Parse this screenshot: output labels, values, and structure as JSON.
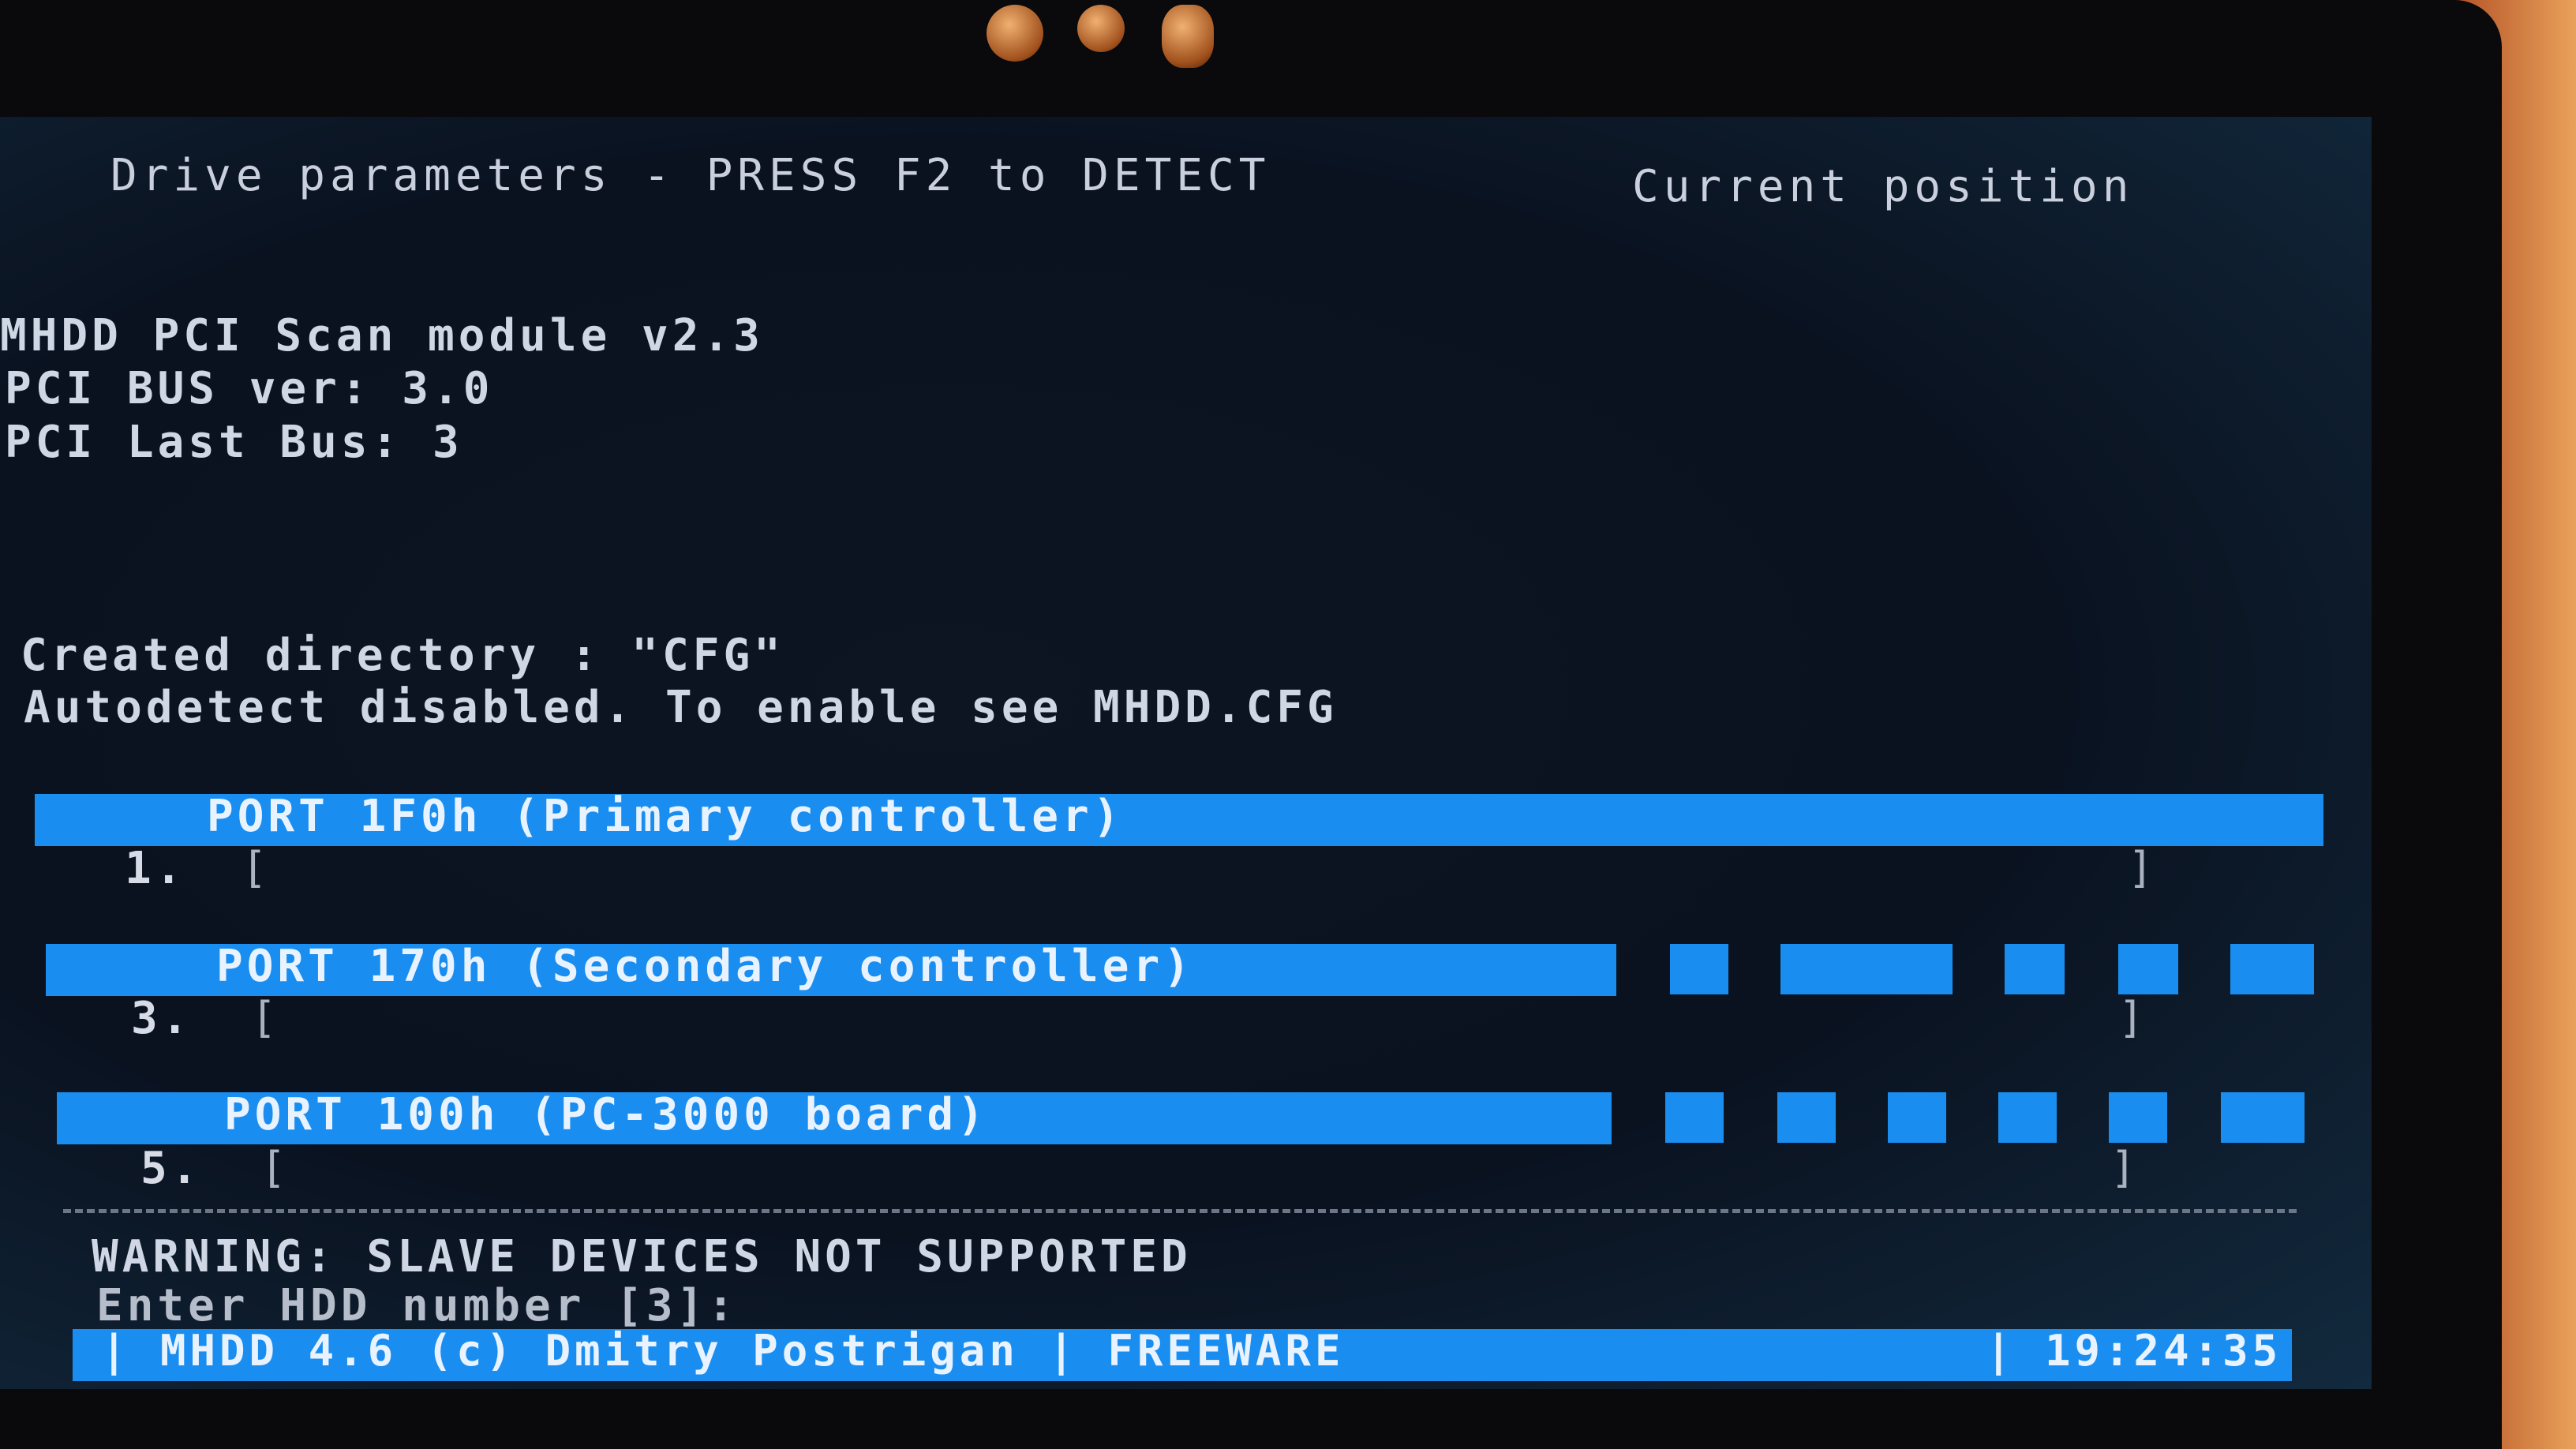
{
  "header": {
    "left": "Drive parameters - PRESS F2 to DETECT",
    "right": "Current position"
  },
  "info_lines": [
    "MHDD PCI Scan module v2.3",
    "PCI BUS ver: 3.0",
    "PCI Last Bus: 3"
  ],
  "messages": [
    "Created directory : \"CFG\"",
    "Autodetect disabled. To enable see MHDD.CFG"
  ],
  "ports": [
    {
      "title": "PORT 1F0h (Primary controller)",
      "number": "1."
    },
    {
      "title": "PORT 170h (Secondary controller)",
      "number": "3."
    },
    {
      "title": "PORT 100h (PC-3000 board)",
      "number": "5."
    }
  ],
  "bracket_open": "[",
  "bracket_close": "]",
  "warning": "WARNING: SLAVE DEVICES NOT SUPPORTED",
  "prompt": "Enter HDD number [3]:",
  "status_bar": {
    "left": "| MHDD 4.6 (c) Dmitry Postrigan | FREEWARE",
    "clock": "| 19:24:35"
  },
  "colors": {
    "accent_bar": "#1a8ef0",
    "background": "#0a1220",
    "text": "#cfd6e4"
  }
}
